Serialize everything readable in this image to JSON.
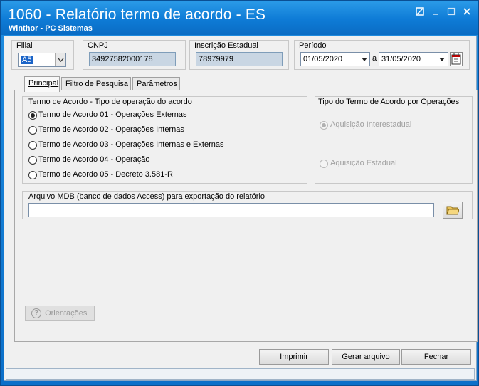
{
  "window": {
    "title": "1060 - Relatório termo de acordo - ES",
    "subtitle": "Winthor - PC Sistemas"
  },
  "header": {
    "filial_label": "Filial",
    "filial_value": "A5",
    "cnpj_label": "CNPJ",
    "cnpj_value": "34927582000178",
    "ie_label": "Inscrição Estadual",
    "ie_value": "78979979",
    "periodo_label": "Período",
    "periodo_start": "01/05/2020",
    "periodo_sep": "a",
    "periodo_end": "31/05/2020"
  },
  "tabs": [
    {
      "label": "Principal"
    },
    {
      "label": "Filtro de Pesquisa"
    },
    {
      "label": "Parâmetros"
    }
  ],
  "termo": {
    "title": "Termo de Acordo - Tipo de operação do acordo",
    "options": [
      {
        "label": "Termo de Acordo 01 - Operações Externas",
        "checked": true
      },
      {
        "label": "Termo de Acordo 02 - Operações Internas",
        "checked": false
      },
      {
        "label": "Termo de Acordo 03 - Operações Internas e Externas",
        "checked": false
      },
      {
        "label": "Termo de Acordo 04 - Operação",
        "checked": false
      },
      {
        "label": "Termo de Acordo 05 - Decreto 3.581-R",
        "checked": false
      }
    ]
  },
  "tipo": {
    "title": "Tipo do Termo de Acordo por Operações",
    "options": [
      {
        "label": "Aquisição Interestadual",
        "checked": true
      },
      {
        "label": "Aquisição Estadual",
        "checked": false
      }
    ]
  },
  "arquivo": {
    "title": "Arquivo MDB (banco de dados Access) para exportação do relatório",
    "value": ""
  },
  "buttons": {
    "orientacoes": "Orientações",
    "imprimir": "Imprimir",
    "gerar": "Gerar arquivo",
    "fechar": "Fechar"
  }
}
